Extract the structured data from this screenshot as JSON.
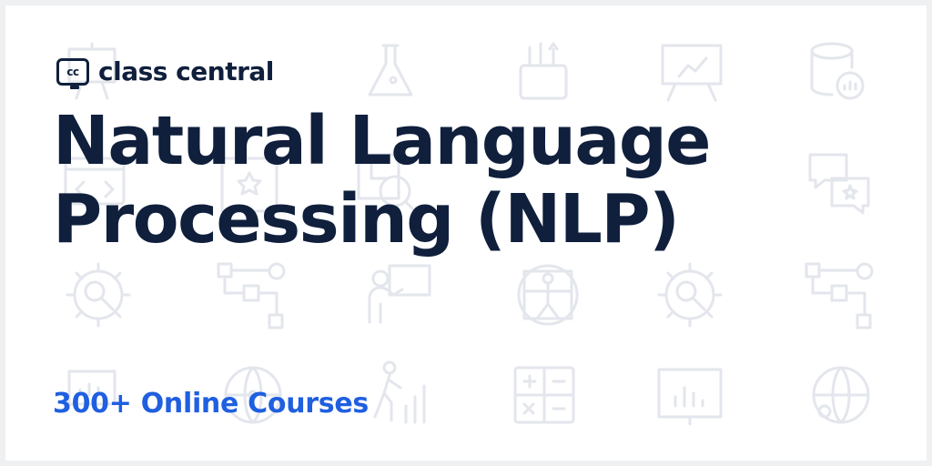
{
  "brand": {
    "logo_mark": "cc",
    "name": "class central"
  },
  "headline": {
    "line1": "Natural Language",
    "line2": "Processing (NLP)"
  },
  "subheadline": "300+ Online Courses",
  "colors": {
    "headline": "#0f1f3c",
    "accent": "#1f5fe0",
    "background_icons": "#e3e6ec"
  },
  "background_icons": [
    "presentation-board-icon",
    "flask-icon",
    "pencil-cup-icon",
    "easel-chart-icon",
    "database-chart-icon",
    "code-window-icon",
    "star-book-icon",
    "magnifier-chart-icon",
    "chat-star-icon",
    "gear-magnifier-icon",
    "flowchart-icon",
    "teacher-icon",
    "vitruvian-man-icon",
    "calculator-icon",
    "growth-person-icon",
    "globe-network-icon",
    "bar-chart-board-icon"
  ]
}
